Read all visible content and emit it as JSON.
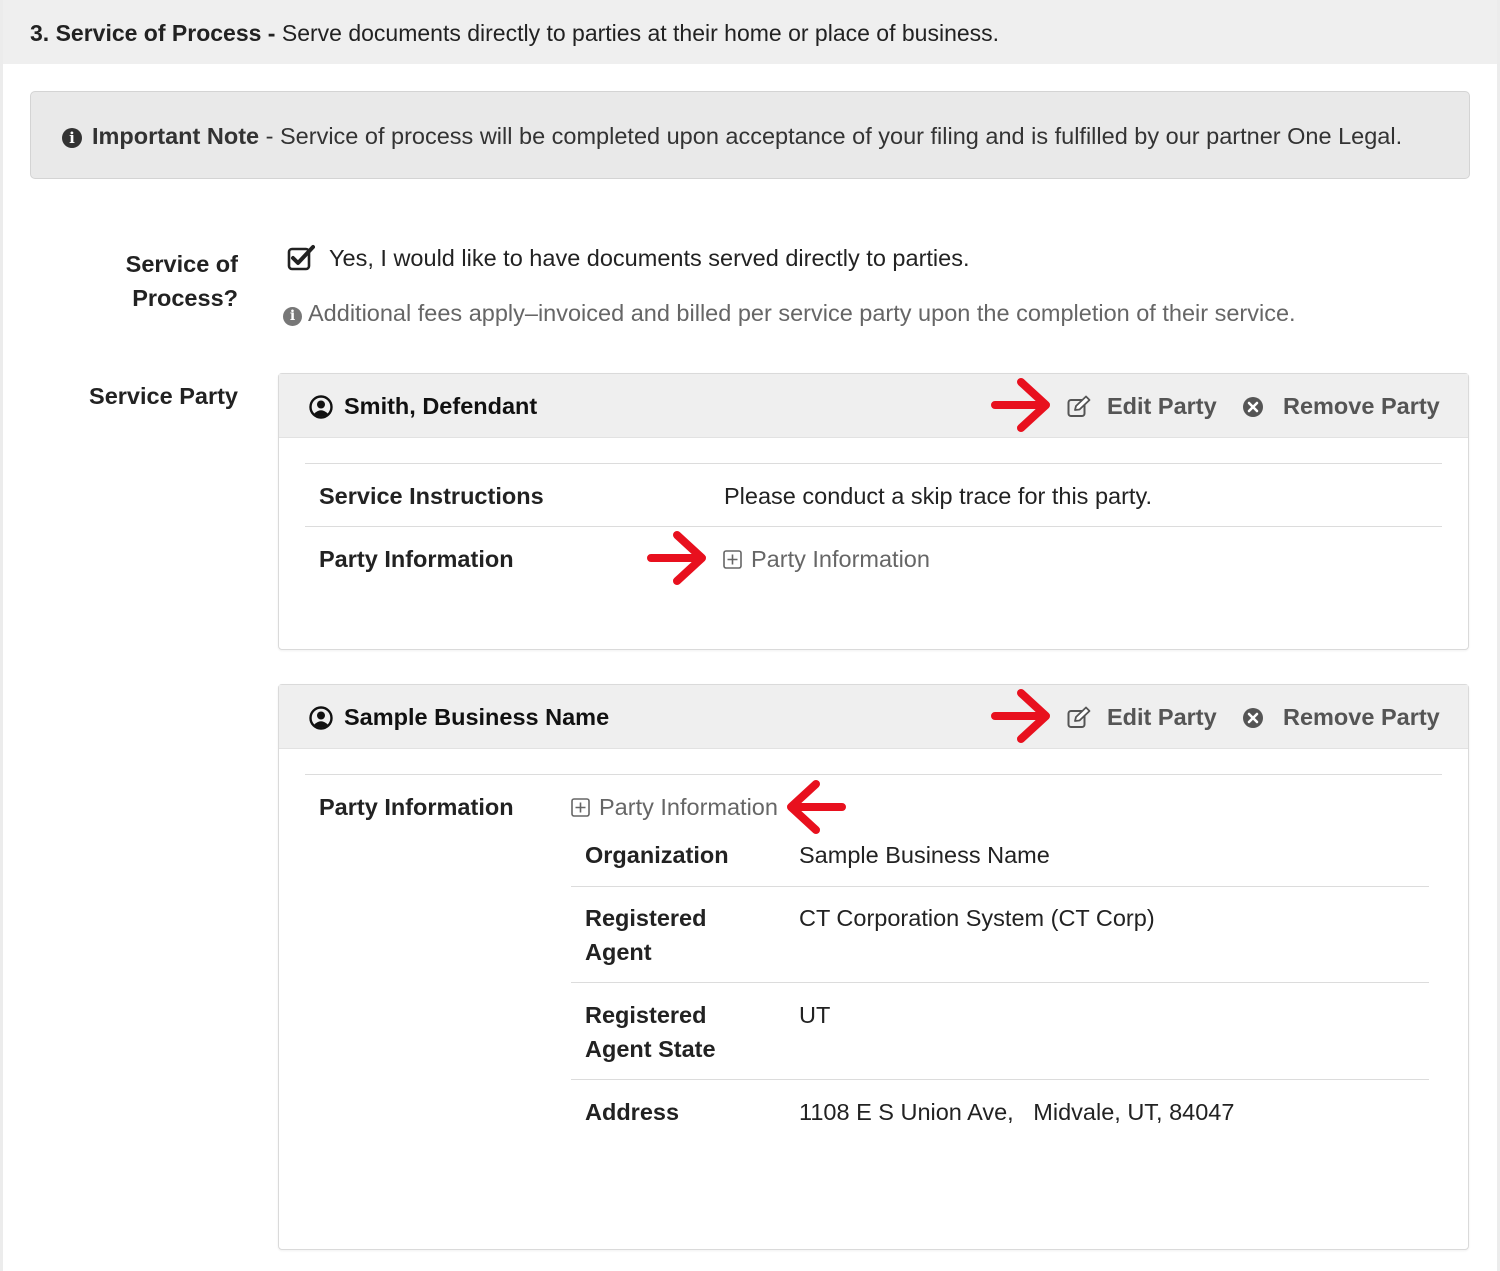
{
  "section": {
    "number": "3. Service of Process -",
    "description": "Serve documents directly to parties at their home or place of business."
  },
  "note": {
    "title": "Important Note",
    "separator": "-",
    "text": "Service of process will be completed upon acceptance of your filing and is fulfilled by our partner One Legal."
  },
  "service_of_process": {
    "label": "Service of Process?",
    "checkbox_label": "Yes, I would like to have documents served directly to parties.",
    "checked": true,
    "fee_note": "Additional fees apply–invoiced and billed per service party upon the completion of their service."
  },
  "service_party_label": "Service Party",
  "parties": [
    {
      "name": "Smith, Defendant",
      "edit_label": "Edit Party",
      "remove_label": "Remove Party",
      "service_instructions_label": "Service Instructions",
      "service_instructions": "Please conduct a skip trace for this party.",
      "party_information_label": "Party Information",
      "party_information_link": "Party Information"
    },
    {
      "name": "Sample Business Name",
      "edit_label": "Edit Party",
      "remove_label": "Remove Party",
      "party_information_label": "Party Information",
      "party_information_link": "Party Information",
      "details": [
        {
          "label": "Organization",
          "value": "Sample Business Name"
        },
        {
          "label": "Registered Agent",
          "value": "CT Corporation System (CT Corp)"
        },
        {
          "label": "Registered Agent State",
          "value": "UT"
        },
        {
          "label": "Address",
          "value": "1108 E S Union Ave,   Midvale, UT, 84047"
        }
      ]
    }
  ],
  "colors": {
    "annotation_arrow": "#e8101e",
    "header_bg": "#efefef",
    "note_bg": "#e9e9e9",
    "muted_text": "#666666"
  }
}
